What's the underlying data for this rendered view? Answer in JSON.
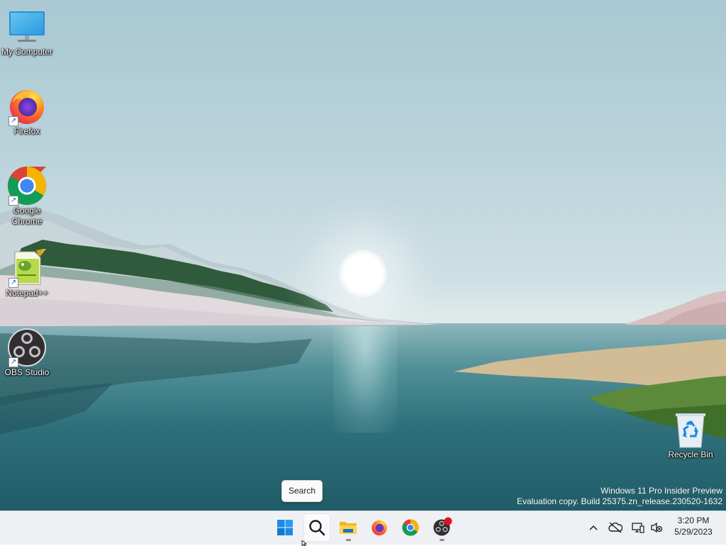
{
  "desktop": {
    "icons": [
      {
        "label": "My Computer",
        "icon": "monitor-icon",
        "shortcut": false
      },
      {
        "label": "Firefox",
        "icon": "firefox-icon",
        "shortcut": true
      },
      {
        "label": "Google Chrome",
        "icon": "chrome-icon",
        "shortcut": true
      },
      {
        "label": "Notepad++",
        "icon": "notepadpp-icon",
        "shortcut": true
      },
      {
        "label": "OBS Studio",
        "icon": "obs-icon",
        "shortcut": true
      },
      {
        "label": "Recycle Bin",
        "icon": "recycle-bin-icon",
        "shortcut": false
      }
    ],
    "shortcut_glyph": "↗"
  },
  "watermark": {
    "line1": "Windows 11 Pro Insider Preview",
    "line2": "Evaluation copy. Build 25375.zn_release.230520-1632"
  },
  "tooltip": {
    "text": "Search"
  },
  "taskbar": {
    "buttons": [
      {
        "name": "start",
        "icon": "windows-start-icon",
        "running": false
      },
      {
        "name": "search",
        "icon": "search-icon",
        "running": false,
        "hovered": true
      },
      {
        "name": "file-explorer",
        "icon": "folder-icon",
        "running": true
      },
      {
        "name": "firefox",
        "icon": "firefox-icon",
        "running": false
      },
      {
        "name": "chrome",
        "icon": "chrome-icon",
        "running": false
      },
      {
        "name": "obs",
        "icon": "obs-icon",
        "running": true,
        "recording": true
      }
    ],
    "tray": {
      "icons": [
        "chevron-up-icon",
        "cloud-offline-icon",
        "network-icon",
        "volume-muted-icon"
      ]
    },
    "clock": {
      "time": "3:20 PM",
      "date": "5/29/2023"
    }
  },
  "colors": {
    "taskbar_bg": "#eef0f3",
    "windows_blue": "#1a8ae6",
    "recording_red": "#e81123"
  }
}
